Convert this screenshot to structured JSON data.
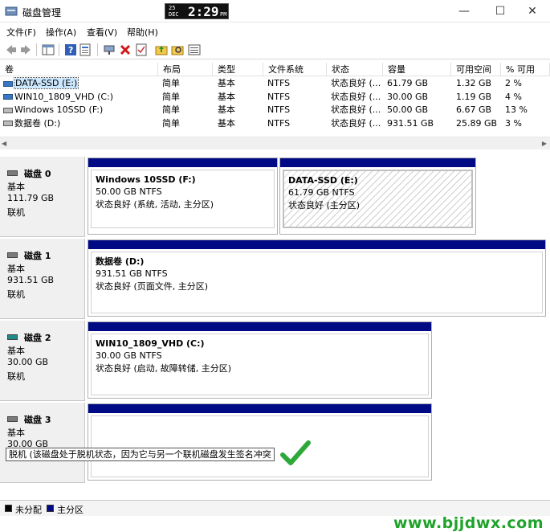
{
  "window": {
    "title": "磁盘管理",
    "clock": {
      "day": "25",
      "month": "DEC",
      "time": "2:29",
      "ampm": "PM"
    },
    "minimize": "—",
    "maximize": "☐",
    "close": "✕"
  },
  "menu": [
    "文件(F)",
    "操作(A)",
    "查看(V)",
    "帮助(H)"
  ],
  "toolbar_icons": [
    "back-icon",
    "forward-icon",
    "view-icon",
    "help-icon",
    "properties-icon",
    "connect-icon",
    "delete-icon",
    "check-icon",
    "up-folder-icon",
    "search-folder-icon",
    "list-icon"
  ],
  "volumes": {
    "columns": [
      "卷",
      "布局",
      "类型",
      "文件系统",
      "状态",
      "容量",
      "可用空间",
      "% 可用"
    ],
    "rows": [
      {
        "name": "DATA-SSD (E:)",
        "layout": "简单",
        "type": "基本",
        "fs": "NTFS",
        "status": "状态良好 (...",
        "capacity": "61.79 GB",
        "free": "1.32 GB",
        "pct": "2 %",
        "selected": true
      },
      {
        "name": "WIN10_1809_VHD (C:)",
        "layout": "简单",
        "type": "基本",
        "fs": "NTFS",
        "status": "状态良好 (...",
        "capacity": "30.00 GB",
        "free": "1.19 GB",
        "pct": "4 %",
        "selected": false
      },
      {
        "name": "Windows 10SSD (F:)",
        "layout": "简单",
        "type": "基本",
        "fs": "NTFS",
        "status": "状态良好 (...",
        "capacity": "50.00 GB",
        "free": "6.67 GB",
        "pct": "13 %",
        "selected": false
      },
      {
        "name": "数据卷 (D:)",
        "layout": "简单",
        "type": "基本",
        "fs": "NTFS",
        "status": "状态良好 (...",
        "capacity": "931.51 GB",
        "free": "25.89 GB",
        "pct": "3 %",
        "selected": false
      }
    ]
  },
  "disks": [
    {
      "title": "磁盘 0",
      "type": "基本",
      "size": "111.79 GB",
      "state": "联机",
      "partitions": [
        {
          "name": "Windows 10SSD  (F:)",
          "size": "50.00 GB NTFS",
          "status": "状态良好 (系统, 活动, 主分区)"
        },
        {
          "name": "DATA-SSD  (E:)",
          "size": "61.79 GB NTFS",
          "status": "状态良好 (主分区)"
        }
      ]
    },
    {
      "title": "磁盘 1",
      "type": "基本",
      "size": "931.51 GB",
      "state": "联机",
      "partitions": [
        {
          "name": "数据卷  (D:)",
          "size": "931.51 GB NTFS",
          "status": "状态良好 (页面文件, 主分区)"
        }
      ]
    },
    {
      "title": "磁盘 2",
      "type": "基本",
      "size": "30.00 GB",
      "state": "联机",
      "partitions": [
        {
          "name": "WIN10_1809_VHD  (C:)",
          "size": "30.00 GB NTFS",
          "status": "状态良好 (启动, 故障转储, 主分区)"
        }
      ]
    },
    {
      "title": "磁盘 3",
      "type": "基本",
      "size": "30.00 GB",
      "state": "",
      "partitions": [
        {
          "name": "",
          "size": "30.00 GB",
          "status": ""
        }
      ]
    }
  ],
  "tooltip": "脱机 (该磁盘处于脱机状态，因为它与另一个联机磁盘发生签名冲突",
  "legend": [
    {
      "label": "未分配",
      "color": "#000000"
    },
    {
      "label": "主分区",
      "color": "#000a85"
    }
  ],
  "watermark": "www.bjjdwx.com",
  "colors": {
    "partition_bar": "#000a85",
    "selection": "#cce8ff",
    "checkmark": "#2fa83a"
  }
}
